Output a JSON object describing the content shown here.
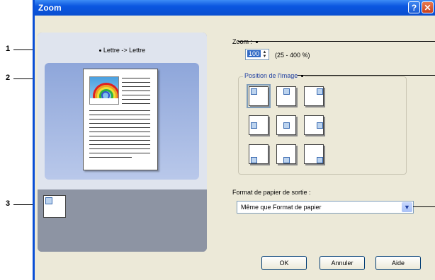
{
  "callouts": [
    "1",
    "2",
    "3"
  ],
  "window": {
    "title": "Zoom",
    "help_glyph": "?",
    "close_glyph": "✕"
  },
  "preview": {
    "paper_label": "Lettre -> Lettre"
  },
  "zoom": {
    "label": "Zoom :",
    "value": "100",
    "range": "(25 - 400 %)"
  },
  "position": {
    "label": "Position de l'image",
    "selected": "top-left"
  },
  "output_format": {
    "label": "Format de papier de sortie :",
    "value": "Même que Format de papier"
  },
  "buttons": {
    "ok": "OK",
    "cancel": "Annuler",
    "help": "Aide"
  }
}
